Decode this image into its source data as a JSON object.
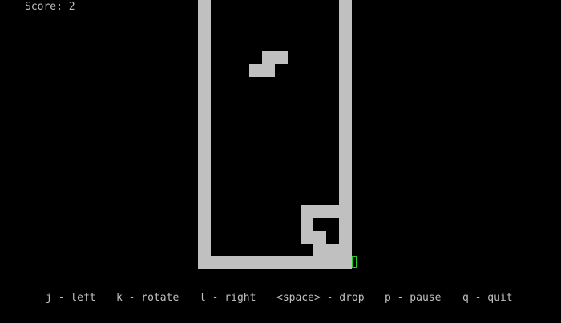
{
  "score_text": "Score: 2",
  "colors": {
    "background": "#000000",
    "block": "#c0c0c0",
    "cursor": "#22cc22"
  },
  "controls": [
    {
      "key": "j",
      "label": "j - left"
    },
    {
      "key": "k",
      "label": "k - rotate"
    },
    {
      "key": "l",
      "label": "l - right"
    },
    {
      "key": "space",
      "label": "<space> - drop"
    },
    {
      "key": "p",
      "label": "p - pause"
    },
    {
      "key": "q",
      "label": "q - quit"
    }
  ]
}
